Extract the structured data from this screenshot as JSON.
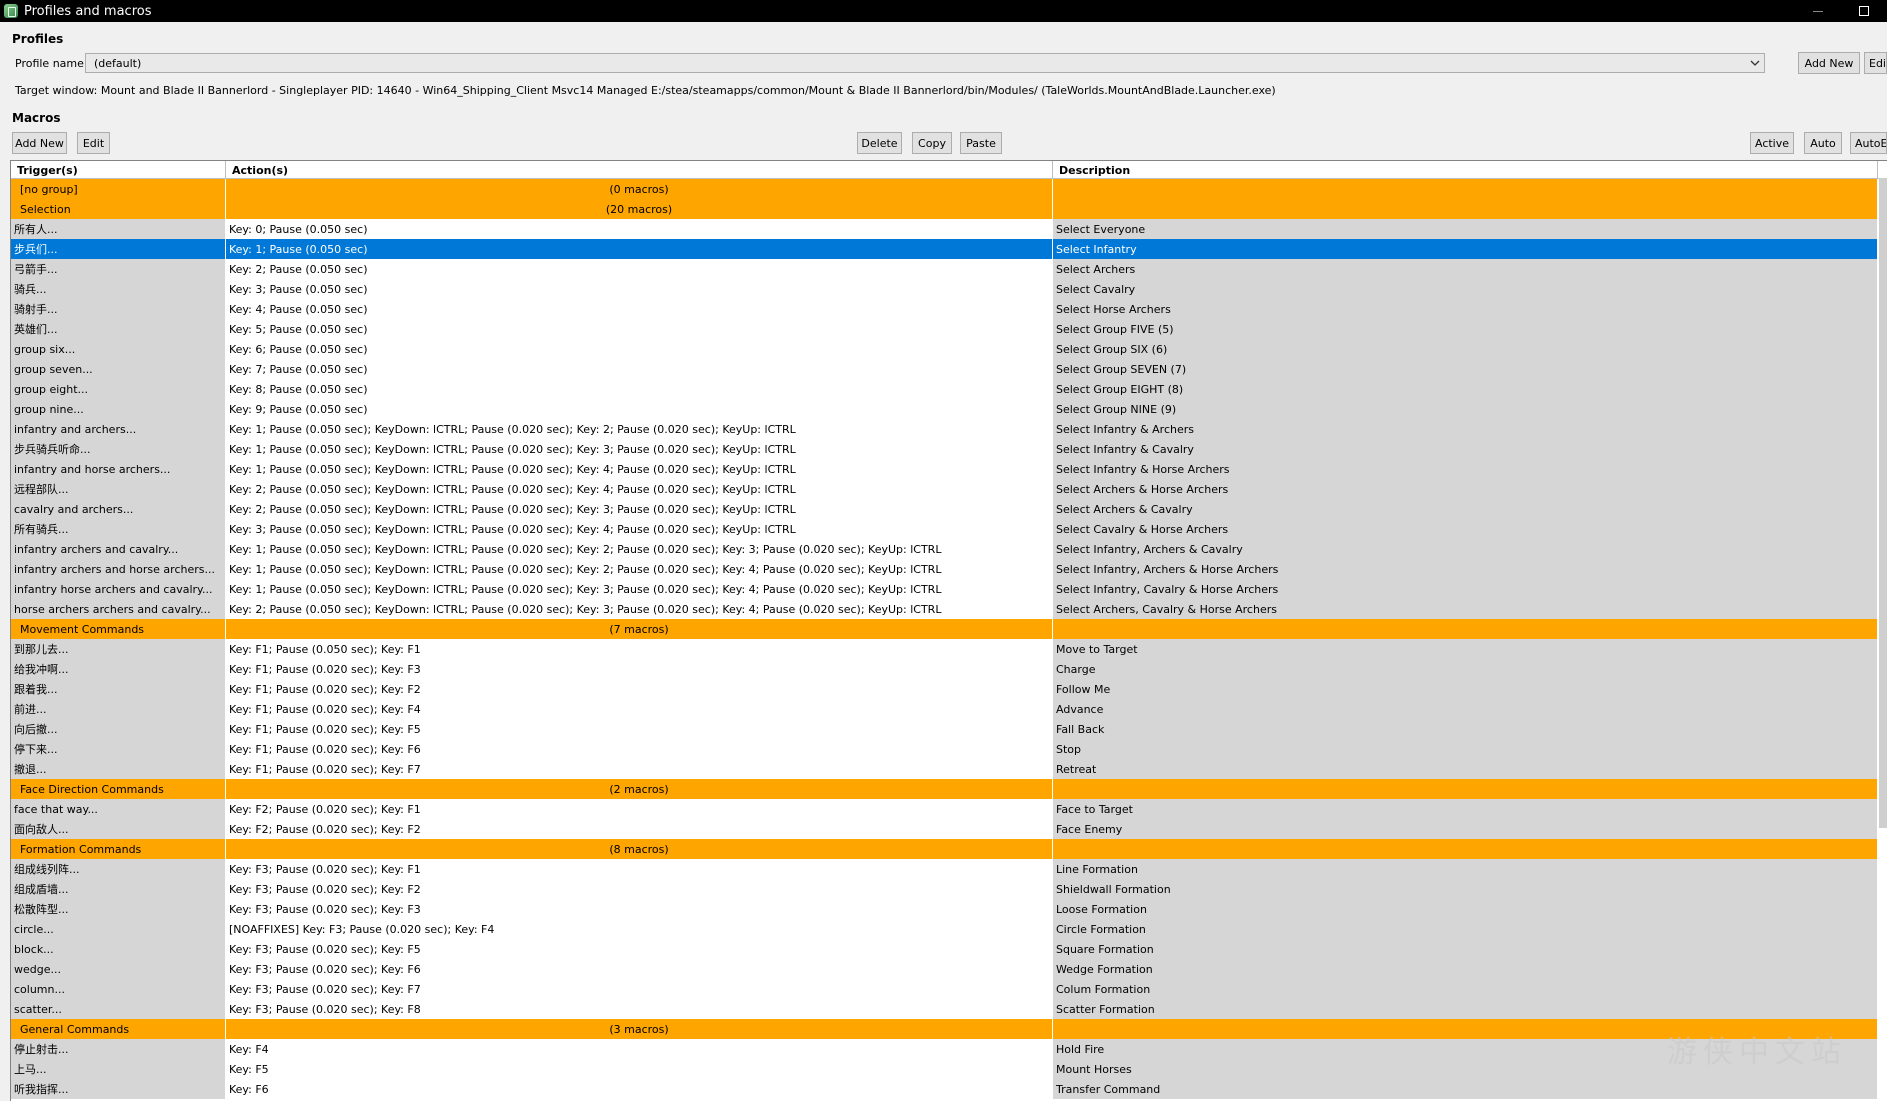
{
  "window": {
    "title": "Profiles and macros",
    "maximize_glyph": "☐"
  },
  "profiles": {
    "section_title": "Profiles",
    "profile_name_label": "Profile name",
    "profile_value": "(default)",
    "add_new_label": "Add New",
    "edit_label": "Edi",
    "target_window": "Target window: Mount and Blade II Bannerlord - Singleplayer PID: 14640 -  Win64_Shipping_Client Msvc14 Managed E:/stea/steamapps/common/Mount & Blade II Bannerlord/bin/Modules/ (TaleWorlds.MountAndBlade.Launcher.exe)"
  },
  "macros": {
    "section_title": "Macros",
    "buttons": {
      "add_new": "Add New",
      "edit": "Edit",
      "delete": "Delete",
      "copy": "Copy",
      "paste": "Paste",
      "active": "Active",
      "auto": "Auto",
      "autoex": "AutoEx"
    },
    "columns": {
      "trigger": "Trigger(s)",
      "action": "Action(s)",
      "description": "Description"
    },
    "rows": [
      {
        "group": true,
        "trigger": "[no group]",
        "action": "(0 macros)",
        "desc": ""
      },
      {
        "group": true,
        "trigger": "Selection",
        "action": "(20 macros)",
        "desc": ""
      },
      {
        "trigger": "所有人...",
        "action": "Key: 0; Pause (0.050 sec)",
        "desc": "Select Everyone"
      },
      {
        "selected": true,
        "trigger": "步兵们...",
        "action": "Key: 1; Pause (0.050 sec)",
        "desc": "Select Infantry"
      },
      {
        "trigger": "弓箭手...",
        "action": "Key: 2; Pause (0.050 sec)",
        "desc": "Select Archers"
      },
      {
        "trigger": "骑兵...",
        "action": "Key: 3; Pause (0.050 sec)",
        "desc": "Select Cavalry"
      },
      {
        "trigger": "骑射手...",
        "action": "Key: 4; Pause (0.050 sec)",
        "desc": "Select Horse Archers"
      },
      {
        "trigger": "英雄们...",
        "action": "Key: 5; Pause (0.050 sec)",
        "desc": "Select Group FIVE (5)"
      },
      {
        "trigger": "group six...",
        "action": "Key: 6; Pause (0.050 sec)",
        "desc": "Select Group SIX (6)"
      },
      {
        "trigger": "group seven...",
        "action": "Key: 7; Pause (0.050 sec)",
        "desc": "Select Group SEVEN (7)"
      },
      {
        "trigger": "group eight...",
        "action": "Key: 8; Pause (0.050 sec)",
        "desc": "Select Group EIGHT (8)"
      },
      {
        "trigger": "group nine...",
        "action": "Key: 9; Pause (0.050 sec)",
        "desc": "Select Group NINE (9)"
      },
      {
        "trigger": "infantry and archers...",
        "action": "Key: 1; Pause (0.050 sec); KeyDown: lCTRL; Pause (0.020 sec); Key: 2; Pause (0.020 sec); KeyUp: lCTRL",
        "desc": "Select Infantry & Archers"
      },
      {
        "trigger": "步兵骑兵听命...",
        "action": "Key: 1; Pause (0.050 sec); KeyDown: lCTRL; Pause (0.020 sec); Key: 3; Pause (0.020 sec); KeyUp: lCTRL",
        "desc": "Select Infantry & Cavalry"
      },
      {
        "trigger": "infantry and horse archers...",
        "action": "Key: 1; Pause (0.050 sec); KeyDown: lCTRL; Pause (0.020 sec); Key: 4; Pause (0.020 sec); KeyUp: lCTRL",
        "desc": "Select Infantry & Horse Archers"
      },
      {
        "trigger": "远程部队...",
        "action": "Key: 2; Pause (0.050 sec); KeyDown: lCTRL; Pause (0.020 sec); Key: 4; Pause (0.020 sec); KeyUp: lCTRL",
        "desc": "Select Archers & Horse Archers"
      },
      {
        "trigger": "cavalry and archers...",
        "action": "Key: 2; Pause (0.050 sec); KeyDown: lCTRL; Pause (0.020 sec); Key: 3; Pause (0.020 sec); KeyUp: lCTRL",
        "desc": "Select Archers & Cavalry"
      },
      {
        "trigger": "所有骑兵...",
        "action": "Key: 3; Pause (0.050 sec); KeyDown: lCTRL; Pause (0.020 sec); Key: 4; Pause (0.020 sec); KeyUp: lCTRL",
        "desc": "Select Cavalry & Horse Archers"
      },
      {
        "trigger": "infantry archers and cavalry...",
        "action": "Key: 1; Pause (0.050 sec); KeyDown: lCTRL; Pause (0.020 sec); Key: 2; Pause (0.020 sec); Key: 3; Pause (0.020 sec); KeyUp: lCTRL",
        "desc": "Select Infantry, Archers & Cavalry"
      },
      {
        "trigger": "infantry archers and horse archers...",
        "action": "Key: 1; Pause (0.050 sec); KeyDown: lCTRL; Pause (0.020 sec); Key: 2; Pause (0.020 sec); Key: 4; Pause (0.020 sec); KeyUp: lCTRL",
        "desc": "Select Infantry, Archers & Horse Archers"
      },
      {
        "trigger": "infantry horse archers and cavalry...",
        "action": "Key: 1; Pause (0.050 sec); KeyDown: lCTRL; Pause (0.020 sec); Key: 3; Pause (0.020 sec); Key: 4; Pause (0.020 sec); KeyUp: lCTRL",
        "desc": "Select Infantry, Cavalry & Horse Archers"
      },
      {
        "trigger": "horse archers archers and cavalry...",
        "action": "Key: 2; Pause (0.050 sec); KeyDown: lCTRL; Pause (0.020 sec); Key: 3; Pause (0.020 sec); Key: 4; Pause (0.020 sec); KeyUp: lCTRL",
        "desc": "Select Archers, Cavalry & Horse Archers"
      },
      {
        "group": true,
        "trigger": "Movement Commands",
        "action": "(7 macros)",
        "desc": ""
      },
      {
        "trigger": "到那儿去...",
        "action": "Key: F1; Pause (0.050 sec); Key: F1",
        "desc": "Move to Target"
      },
      {
        "trigger": "给我冲啊...",
        "action": "Key: F1; Pause (0.020 sec); Key: F3",
        "desc": "Charge"
      },
      {
        "trigger": "跟着我...",
        "action": "Key: F1; Pause (0.020 sec); Key: F2",
        "desc": "Follow Me"
      },
      {
        "trigger": "前进...",
        "action": "Key: F1; Pause (0.020 sec); Key: F4",
        "desc": "Advance"
      },
      {
        "trigger": "向后撤...",
        "action": "Key: F1; Pause (0.020 sec); Key: F5",
        "desc": "Fall Back"
      },
      {
        "trigger": "停下来...",
        "action": "Key: F1; Pause (0.020 sec); Key: F6",
        "desc": "Stop"
      },
      {
        "trigger": "撤退...",
        "action": "Key: F1; Pause (0.020 sec); Key: F7",
        "desc": "Retreat"
      },
      {
        "group": true,
        "trigger": "Face Direction Commands",
        "action": "(2 macros)",
        "desc": ""
      },
      {
        "trigger": "face that way...",
        "action": "Key: F2; Pause (0.020 sec); Key: F1",
        "desc": "Face to Target"
      },
      {
        "trigger": "面向敌人...",
        "action": "Key: F2; Pause (0.020 sec); Key: F2",
        "desc": "Face Enemy"
      },
      {
        "group": true,
        "trigger": "Formation Commands",
        "action": "(8 macros)",
        "desc": ""
      },
      {
        "trigger": "组成线列阵...",
        "action": "Key: F3; Pause (0.020 sec); Key: F1",
        "desc": "Line Formation"
      },
      {
        "trigger": "组成盾墙...",
        "action": "Key: F3; Pause (0.020 sec); Key: F2",
        "desc": "Shieldwall Formation"
      },
      {
        "trigger": "松散阵型...",
        "action": "Key: F3; Pause (0.020 sec); Key: F3",
        "desc": "Loose Formation"
      },
      {
        "trigger": "circle...",
        "action": "[NOAFFIXES] Key: F3; Pause (0.020 sec); Key: F4",
        "desc": "Circle Formation"
      },
      {
        "trigger": "block...",
        "action": "Key: F3; Pause (0.020 sec); Key: F5",
        "desc": "Square Formation"
      },
      {
        "trigger": "wedge...",
        "action": "Key: F3; Pause (0.020 sec); Key: F6",
        "desc": "Wedge Formation"
      },
      {
        "trigger": "column...",
        "action": "Key: F3; Pause (0.020 sec); Key: F7",
        "desc": "Colum Formation"
      },
      {
        "trigger": "scatter...",
        "action": "Key: F3; Pause (0.020 sec); Key: F8",
        "desc": "Scatter Formation"
      },
      {
        "group": true,
        "trigger": "General Commands",
        "action": "(3 macros)",
        "desc": ""
      },
      {
        "trigger": "停止射击...",
        "action": "Key: F4",
        "desc": "Hold Fire"
      },
      {
        "trigger": "上马...",
        "action": "Key: F5",
        "desc": "Mount Horses"
      },
      {
        "trigger": "听我指挥...",
        "action": "Key: F6",
        "desc": "Transfer Command"
      }
    ]
  },
  "watermark": "游侠中文站"
}
